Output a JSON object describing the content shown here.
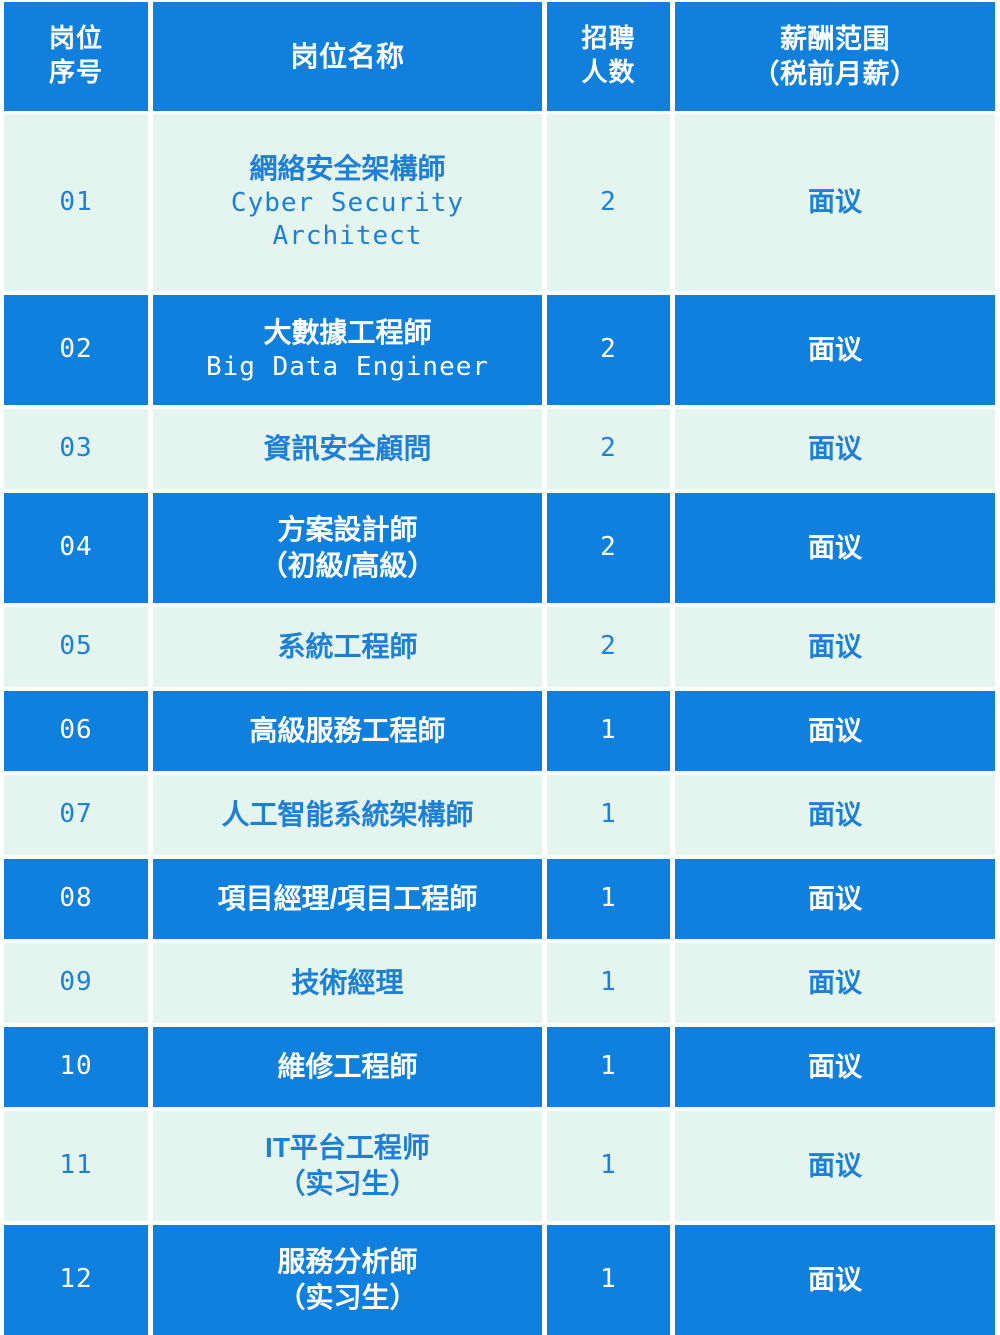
{
  "table": {
    "headers": {
      "no": "岗位\n序号",
      "no_line1": "岗位",
      "no_line2": "序号",
      "title": "岗位名称",
      "count_line1": "招聘",
      "count_line2": "人数",
      "salary_line1": "薪酬范围",
      "salary_line2": "（税前月薪）"
    },
    "colors": {
      "brand_blue": "#0f80dd",
      "header_blue": "#1080dc",
      "light_row_bg": "#e4f4ef",
      "light_row_text": "#1d7fd6",
      "dark_row_text": "#ffffff",
      "page_bg": "#ffffff"
    },
    "rows": [
      {
        "no": "01",
        "title_cn": "網絡安全架構師",
        "title_en": "Cyber Security",
        "title_en2": "Architect",
        "title_sub": "",
        "count": "2",
        "salary": "面议",
        "style": "light",
        "height": "triple"
      },
      {
        "no": "02",
        "title_cn": "大數據工程師",
        "title_en": "Big Data Engineer",
        "title_en2": "",
        "title_sub": "",
        "count": "2",
        "salary": "面议",
        "style": "dark",
        "height": "double"
      },
      {
        "no": "03",
        "title_cn": "資訊安全顧問",
        "title_en": "",
        "title_en2": "",
        "title_sub": "",
        "count": "2",
        "salary": "面议",
        "style": "light",
        "height": "single"
      },
      {
        "no": "04",
        "title_cn": "方案設計師",
        "title_en": "",
        "title_en2": "",
        "title_sub": "（初級/高級）",
        "count": "2",
        "salary": "面议",
        "style": "dark",
        "height": "double"
      },
      {
        "no": "05",
        "title_cn": "系統工程師",
        "title_en": "",
        "title_en2": "",
        "title_sub": "",
        "count": "2",
        "salary": "面议",
        "style": "light",
        "height": "single"
      },
      {
        "no": "06",
        "title_cn": "高級服務工程師",
        "title_en": "",
        "title_en2": "",
        "title_sub": "",
        "count": "1",
        "salary": "面议",
        "style": "dark",
        "height": "single"
      },
      {
        "no": "07",
        "title_cn": "人工智能系統架構師",
        "title_en": "",
        "title_en2": "",
        "title_sub": "",
        "count": "1",
        "salary": "面议",
        "style": "light",
        "height": "single"
      },
      {
        "no": "08",
        "title_cn": "項目經理/項目工程師",
        "title_en": "",
        "title_en2": "",
        "title_sub": "",
        "count": "1",
        "salary": "面议",
        "style": "dark",
        "height": "single"
      },
      {
        "no": "09",
        "title_cn": "技術經理",
        "title_en": "",
        "title_en2": "",
        "title_sub": "",
        "count": "1",
        "salary": "面议",
        "style": "light",
        "height": "single"
      },
      {
        "no": "10",
        "title_cn": "維修工程師",
        "title_en": "",
        "title_en2": "",
        "title_sub": "",
        "count": "1",
        "salary": "面议",
        "style": "dark",
        "height": "single"
      },
      {
        "no": "11",
        "title_cn": "IT平台工程师",
        "title_en": "",
        "title_en2": "",
        "title_sub": "（实习生）",
        "count": "1",
        "salary": "面议",
        "style": "light",
        "height": "double"
      },
      {
        "no": "12",
        "title_cn": "服務分析師",
        "title_en": "",
        "title_en2": "",
        "title_sub": "（实习生）",
        "count": "1",
        "salary": "面议",
        "style": "dark",
        "height": "double"
      }
    ]
  }
}
